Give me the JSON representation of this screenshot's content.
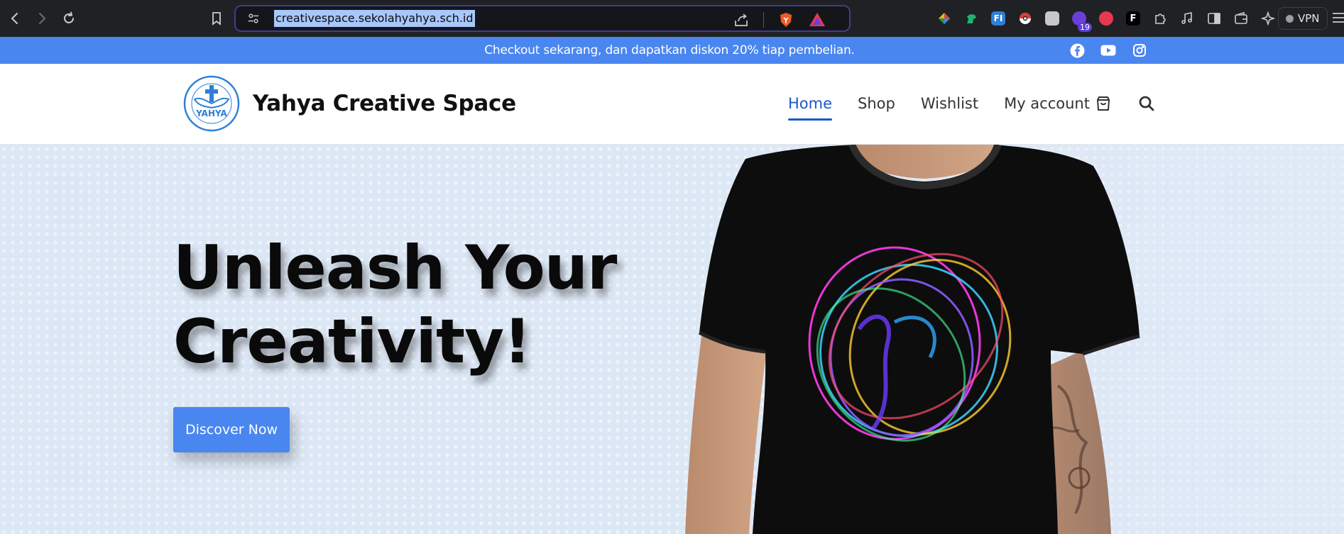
{
  "browser": {
    "url": "creativespace.sekolahyahya.sch.id",
    "vpn_label": "VPN",
    "extension_badge_count": "19",
    "icons": [
      "back-icon",
      "forward-icon",
      "reload-icon",
      "bookmark-icon",
      "site-info-icon",
      "share-icon",
      "brave-shields-icon",
      "brave-rewards-icon",
      "extensions-icon",
      "media-icon",
      "sidebar-icon",
      "wallet-icon",
      "leo-icon",
      "menu-icon"
    ]
  },
  "promo": {
    "text": "Checkout sekarang, dan dapatkan diskon 20% tiap pembelian.",
    "background": "#4a86f0",
    "social_icons": [
      "facebook-icon",
      "youtube-icon",
      "instagram-icon"
    ]
  },
  "header": {
    "brand": "Yahya Creative Space",
    "logo_text": "YAHYA",
    "nav": [
      {
        "label": "Home",
        "active": true
      },
      {
        "label": "Shop",
        "active": false
      },
      {
        "label": "Wishlist",
        "active": false
      },
      {
        "label": "My account",
        "active": false
      }
    ],
    "accent": "#1b58c7",
    "icons": [
      "cart-icon",
      "search-icon"
    ]
  },
  "hero": {
    "headline_line1": "Unleash Your",
    "headline_line2": "Creativity!",
    "cta_label": "Discover Now",
    "cta_color": "#4a86f0"
  }
}
